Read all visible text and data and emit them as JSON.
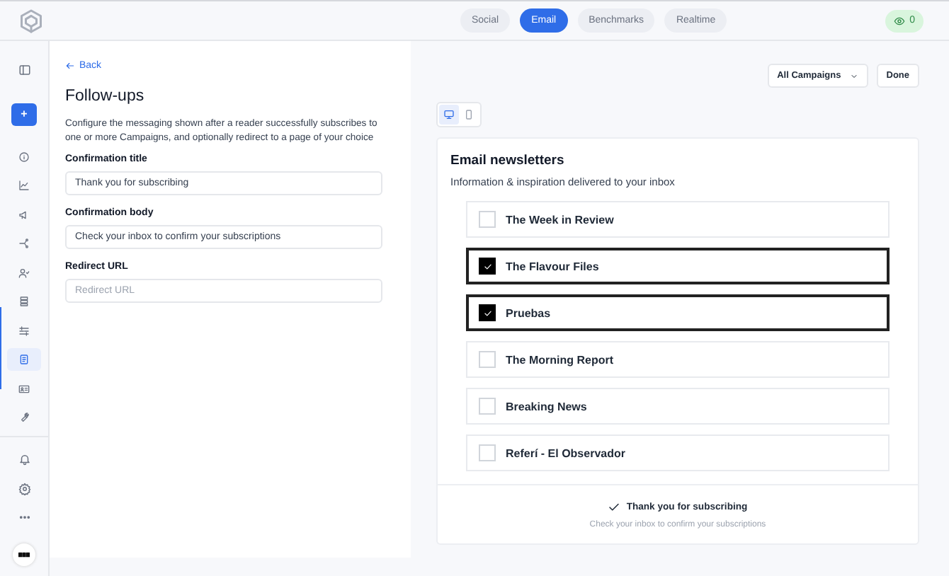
{
  "topbar": {
    "tabs": [
      {
        "label": "Social",
        "selected": false
      },
      {
        "label": "Email",
        "selected": true
      },
      {
        "label": "Benchmarks",
        "selected": false
      },
      {
        "label": "Realtime",
        "selected": false
      }
    ],
    "viewers": "0"
  },
  "sidebar": {
    "add_button": "+",
    "items": [
      {
        "kind": "info",
        "selected": false
      },
      {
        "kind": "chart",
        "selected": false
      },
      {
        "kind": "megaphone",
        "selected": false
      },
      {
        "kind": "share",
        "selected": false
      },
      {
        "kind": "users",
        "selected": false
      },
      {
        "kind": "list",
        "selected": false
      },
      {
        "kind": "sliders",
        "selected": false
      },
      {
        "kind": "document",
        "selected": true
      },
      {
        "kind": "card",
        "selected": false
      },
      {
        "kind": "wrench",
        "selected": false
      }
    ],
    "bottom_items": [
      {
        "kind": "bell"
      },
      {
        "kind": "gear"
      },
      {
        "kind": "more"
      }
    ]
  },
  "form": {
    "back": "Back",
    "title": "Follow-ups",
    "description": "Configure the messaging shown after a reader successfully subscribes to one or more Campaigns, and optionally redirect to a page of your choice",
    "fields": [
      {
        "label": "Confirmation title",
        "value": "Thank you for subscribing"
      },
      {
        "label": "Confirmation body",
        "value": "Check your inbox to confirm your subscriptions"
      },
      {
        "label": "Redirect URL",
        "placeholder": "Redirect URL"
      }
    ]
  },
  "preview": {
    "campaign_filter": "All Campaigns",
    "done": "Done",
    "devices": [
      {
        "kind": "desktop",
        "selected": true
      },
      {
        "kind": "mobile",
        "selected": false
      }
    ],
    "title": "Email newsletters",
    "subtitle": "Information & inspiration delivered to your inbox",
    "newsletters": [
      {
        "name": "The Week in Review",
        "checked": false
      },
      {
        "name": "The Flavour Files",
        "checked": true
      },
      {
        "name": "Pruebas",
        "checked": true
      },
      {
        "name": "The Morning Report",
        "checked": false
      },
      {
        "name": "Breaking News",
        "checked": false
      },
      {
        "name": "Referí - El Observador",
        "checked": false
      }
    ],
    "confirmation_title": "Thank you for subscribing",
    "confirmation_body": "Check your inbox to confirm your subscriptions"
  }
}
